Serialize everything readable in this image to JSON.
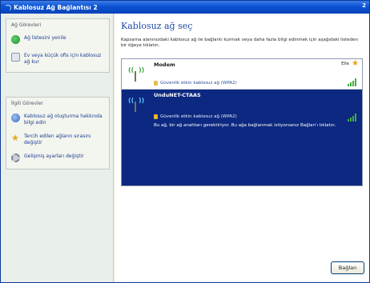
{
  "window": {
    "title": "Kablosuz Ağ Bağlantısı 2",
    "title_suffix": "2"
  },
  "sidebar": {
    "network_tasks": {
      "header": "Ağ Görevleri",
      "items": [
        {
          "label": "Ağ listesini yenile",
          "icon": "refresh-icon"
        },
        {
          "label": "Ev veya küçük ofis için kablosuz ağ kur",
          "icon": "wireless-setup-icon"
        }
      ]
    },
    "related_tasks": {
      "header": "İlgili Görevler",
      "items": [
        {
          "label": "Kablosuz ağ oluşturma hakkında bilgi edin",
          "icon": "info-icon"
        },
        {
          "label": "Tercih edilen ağların sırasını değiştir",
          "icon": "star-icon"
        },
        {
          "label": "Gelişmiş ayarları değiştir",
          "icon": "gear-icon"
        }
      ]
    }
  },
  "main": {
    "heading": "Kablosuz ağ seç",
    "description": "Kapsama alanınızdaki kablosuz ağ ile bağlantı kurmak veya daha fazla bilgi edinmek için aşağıdaki listeden bir öğeye tıklatın.",
    "networks": [
      {
        "name": "Modem",
        "status": "Elle",
        "security": "Güvenlik etkin kablosuz ağ (WPA2)",
        "preferred": true,
        "signal": 0.8
      },
      {
        "name": "UnduNET-CTAAS",
        "status": "",
        "security": "Güvenlik etkin kablosuz ağ (WPA2)",
        "note": "Bu ağ, bir ağ anahtarı gerektiriyor. Bu ağa bağlanmak istiyorsanız Bağlan'ı tıklatın.",
        "preferred": false,
        "signal": 0.8
      }
    ],
    "connect_button": "Bağlan"
  },
  "colors": {
    "title_bar": "#0a52d4",
    "selected_row": "#0c2880",
    "heading": "#1d4aa8",
    "signal": "#3fae3f"
  }
}
